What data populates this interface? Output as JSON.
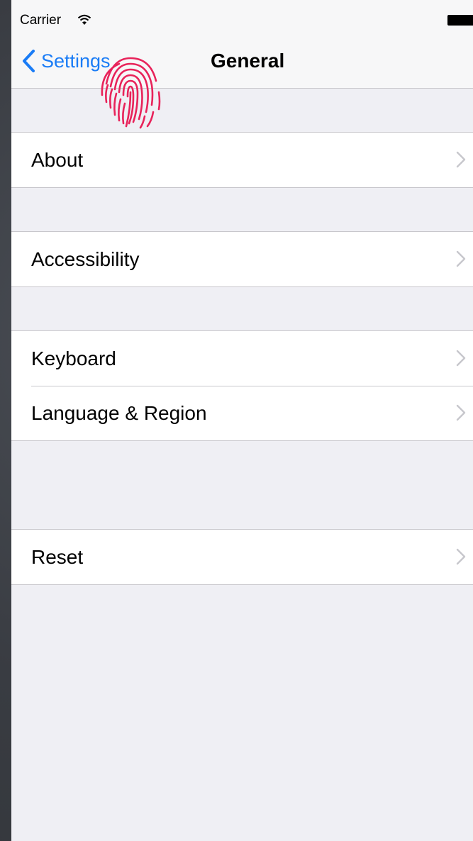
{
  "status_bar": {
    "carrier": "Carrier",
    "wifi_icon": "wifi-icon",
    "battery_icon": "battery-icon"
  },
  "nav_bar": {
    "back_label": "Settings",
    "title": "General",
    "overlay_icon": "fingerprint-icon",
    "overlay_color": "#e8235a",
    "accent_color": "#1a7cf6"
  },
  "groups": [
    {
      "items": [
        {
          "label": "About"
        }
      ]
    },
    {
      "items": [
        {
          "label": "Accessibility"
        }
      ]
    },
    {
      "items": [
        {
          "label": "Keyboard"
        },
        {
          "label": "Language & Region"
        }
      ]
    },
    {
      "items": [
        {
          "label": "Reset"
        }
      ]
    }
  ]
}
